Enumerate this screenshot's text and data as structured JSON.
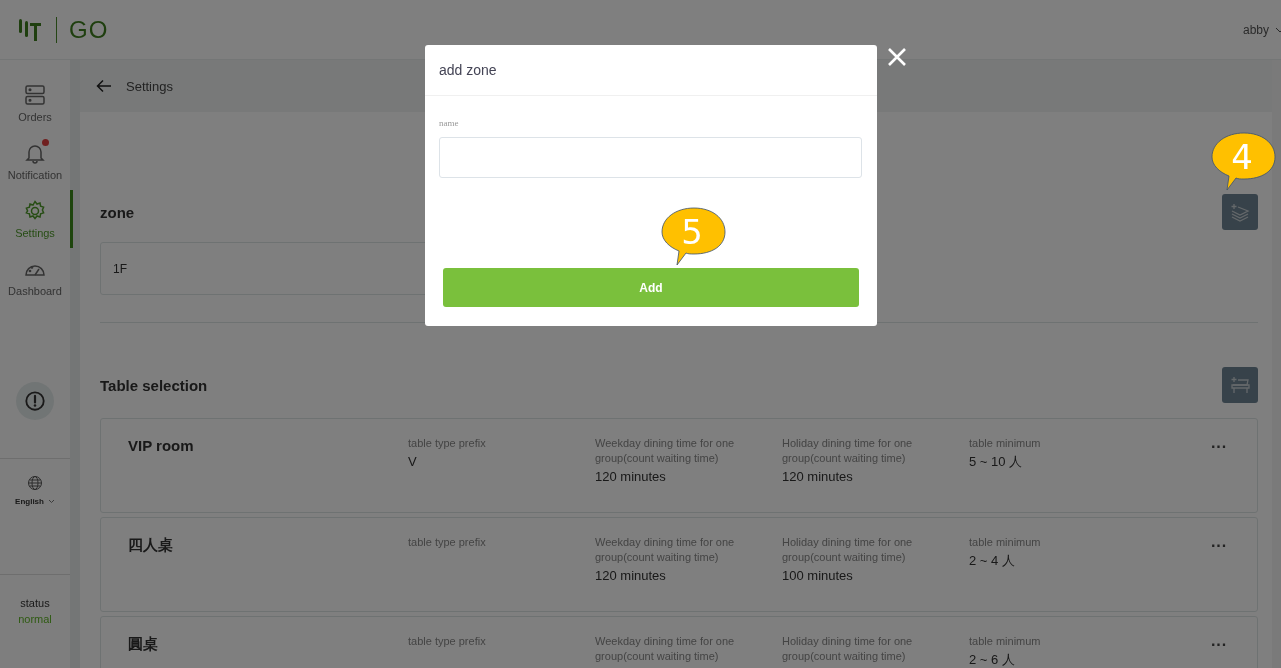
{
  "header": {
    "logo": "GO",
    "user": "abby"
  },
  "sidebar": {
    "items": [
      {
        "label": "Orders",
        "selected": false,
        "unread": false
      },
      {
        "label": "Notification",
        "selected": false,
        "unread": true
      },
      {
        "label": "Settings",
        "selected": true,
        "unread": false
      },
      {
        "label": "Dashboard",
        "selected": false,
        "unread": false
      }
    ],
    "language": "English",
    "status_label": "status",
    "status": "normal"
  },
  "breadcrumb": {
    "title": "Settings"
  },
  "zone_section": {
    "title": "zone",
    "zones": [
      {
        "name": "1F"
      }
    ]
  },
  "table_section": {
    "title": "Table selection",
    "tables": [
      {
        "name": "VIP room",
        "menu": "···",
        "fields": [
          {
            "label": "table type prefix",
            "value": "V"
          },
          {
            "label": "Weekday dining time for one group(count waiting time)",
            "value": "120 minutes"
          },
          {
            "label": "Holiday dining time for one group(count waiting time)",
            "value": "120 minutes"
          },
          {
            "label": "table minimum",
            "value": "5 ~ 10 人"
          }
        ]
      },
      {
        "name": "四人桌",
        "menu": "···",
        "fields": [
          {
            "label": "table type prefix"
          },
          {
            "label": "Weekday dining time for one group(count waiting time)",
            "value": "120 minutes"
          },
          {
            "label": "Holiday dining time for one group(count waiting time)",
            "value": "100 minutes"
          },
          {
            "label": "table minimum",
            "value": "2 ~ 4 人"
          }
        ]
      },
      {
        "name": "圓桌",
        "menu": "···",
        "fields": [
          {
            "label": "table type prefix"
          },
          {
            "label": "Weekday dining time for one group(count waiting time)"
          },
          {
            "label": "Holiday dining time for one group(count waiting time)"
          },
          {
            "label": "table minimum",
            "value": "2 ~ 6 人"
          }
        ]
      }
    ]
  },
  "modal": {
    "title": "add zone",
    "field_label": "name",
    "button": "Add"
  },
  "callouts": [
    {
      "number": "4"
    },
    {
      "number": "5"
    }
  ]
}
